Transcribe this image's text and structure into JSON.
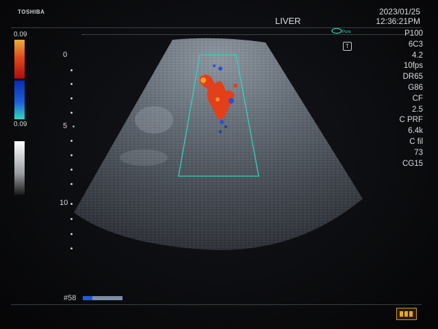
{
  "header": {
    "brand": "TOSHIBA",
    "date": "2023/01/25",
    "time": "12:36:21PM",
    "preset": "LIVER"
  },
  "color_scale": {
    "top_label": "0.09",
    "bottom_label": "0.09",
    "colors": {
      "positive": "#e04a1a",
      "negative": "#1a5ed8",
      "roi_box": "#2fd8c0"
    }
  },
  "depth_labels": [
    "0",
    "5",
    "10"
  ],
  "parameters": [
    "P100",
    "6C3",
    "4.2",
    "10fps",
    "DR65",
    "G86",
    "CF",
    "2.5",
    "C PRF",
    "6.4k",
    "C fil",
    "73",
    "CG15"
  ],
  "footer": {
    "frame_number": "#58",
    "cine_position": 0.24
  },
  "icons": {
    "probe": "probe-orientation-icon",
    "t": "thi-mode-icon",
    "battery": "battery-status-icon"
  }
}
